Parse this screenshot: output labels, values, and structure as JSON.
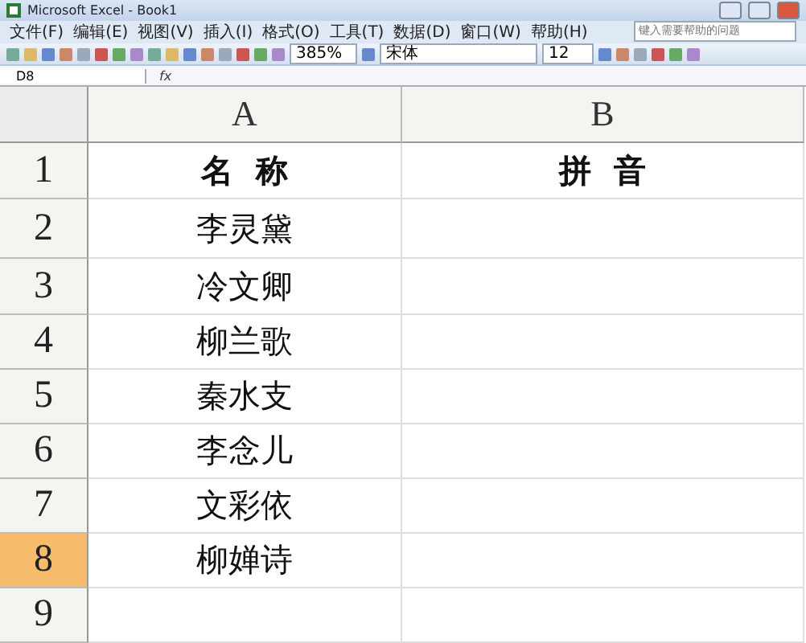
{
  "window": {
    "title": "Microsoft Excel - Book1"
  },
  "menu": [
    {
      "label": "文件(F)"
    },
    {
      "label": "编辑(E)"
    },
    {
      "label": "视图(V)"
    },
    {
      "label": "插入(I)"
    },
    {
      "label": "格式(O)"
    },
    {
      "label": "工具(T)"
    },
    {
      "label": "数据(D)"
    },
    {
      "label": "窗口(W)"
    },
    {
      "label": "帮助(H)"
    }
  ],
  "help_box": {
    "placeholder": "键入需要帮助的问题"
  },
  "toolbar": {
    "zoom": "385%",
    "font": "宋体",
    "size": "12"
  },
  "formula_bar": {
    "name_box": "D8",
    "fx": "fx"
  },
  "columns": [
    {
      "label": "A",
      "selected": false
    },
    {
      "label": "B",
      "selected": false
    }
  ],
  "rows": [
    {
      "number": "1",
      "selected": false,
      "cells": [
        "名  称",
        "拼  音"
      ],
      "bold": true
    },
    {
      "number": "2",
      "selected": false,
      "cells": [
        "李灵黛",
        ""
      ],
      "bold": false
    },
    {
      "number": "3",
      "selected": false,
      "cells": [
        "冷文卿",
        ""
      ],
      "bold": false
    },
    {
      "number": "4",
      "selected": false,
      "cells": [
        "柳兰歌",
        ""
      ],
      "bold": false
    },
    {
      "number": "5",
      "selected": false,
      "cells": [
        "秦水支",
        ""
      ],
      "bold": false
    },
    {
      "number": "6",
      "selected": false,
      "cells": [
        "李念儿",
        ""
      ],
      "bold": false
    },
    {
      "number": "7",
      "selected": false,
      "cells": [
        "文彩依",
        ""
      ],
      "bold": false
    },
    {
      "number": "8",
      "selected": true,
      "cells": [
        "柳婵诗",
        ""
      ],
      "bold": false
    },
    {
      "number": "9",
      "selected": false,
      "cells": [
        "",
        ""
      ]
    }
  ]
}
